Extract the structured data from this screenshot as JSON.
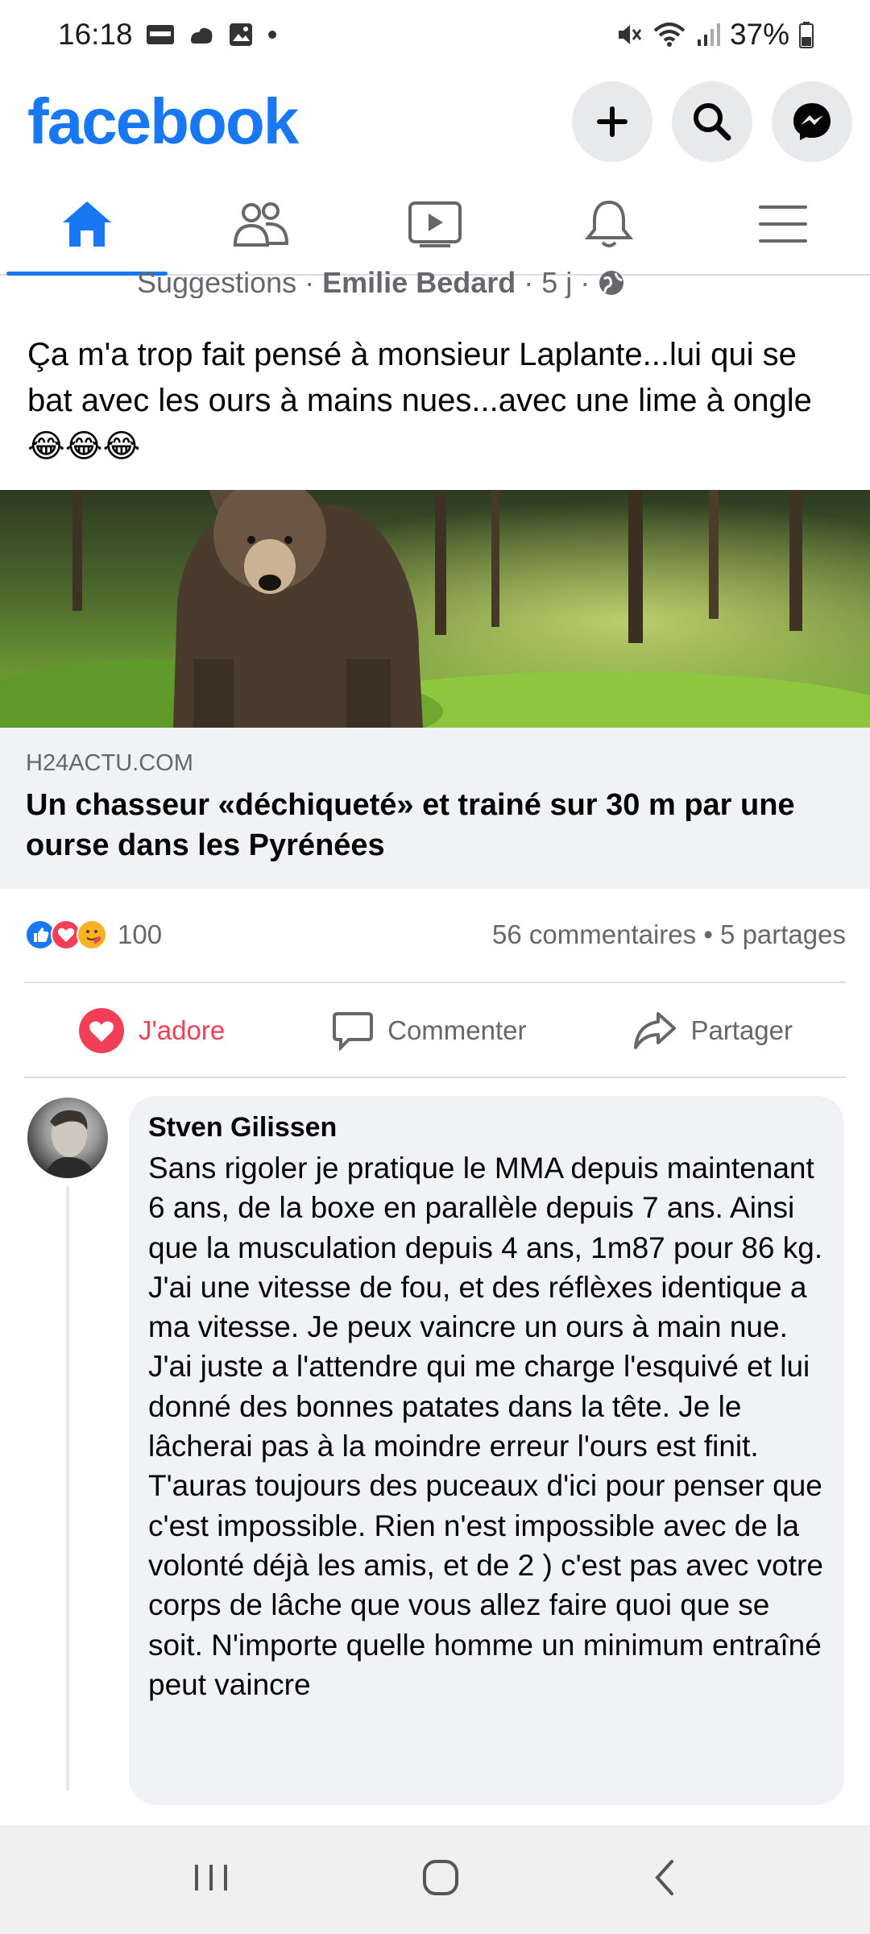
{
  "status_bar": {
    "time": "16:18",
    "battery": "37%"
  },
  "header": {
    "logo": "facebook"
  },
  "tabs": [
    {
      "name": "home",
      "icon": "home-icon",
      "active": true
    },
    {
      "name": "friends",
      "icon": "friends-icon",
      "active": false
    },
    {
      "name": "watch",
      "icon": "video-icon",
      "active": false
    },
    {
      "name": "notifications",
      "icon": "bell-icon",
      "active": false
    },
    {
      "name": "menu",
      "icon": "hamburger-menu-icon",
      "active": false
    }
  ],
  "post": {
    "meta_prefix": "Suggestions · ",
    "author": "Emilie Bedard",
    "meta_suffix": " · 5 j · ",
    "text": "Ça m'a trop fait pensé à monsieur Laplante...lui qui se bat avec les ours à mains nues...avec une lime à ongle 😂😂😂",
    "link": {
      "domain": "H24ACTU.COM",
      "title": "Un chasseur «déchiqueté» et trainé sur 30 m par une ourse dans les Pyrénées"
    },
    "reaction_count": "100",
    "comments_shares": "56 commentaires • 5 partages",
    "actions": {
      "like": "J'adore",
      "comment": "Commenter",
      "share": "Partager"
    }
  },
  "comment": {
    "author": "Stven Gilissen",
    "text": "Sans rigoler je pratique le MMA depuis maintenant 6 ans, de la boxe en parallèle depuis 7 ans. Ainsi que la musculation depuis 4 ans, 1m87 pour 86 kg. J'ai une vitesse de fou, et des réflèxes identique a ma vitesse. Je peux vaincre un ours à main nue. J'ai juste a l'attendre qui me charge l'esquivé et lui donné des bonnes patates dans la tête. Je le lâcherai pas à la moindre erreur l'ours est finit. T'auras toujours des puceaux d'ici pour penser que c'est impossible. Rien n'est impossible avec de la volonté déjà les amis, et de 2 ) c'est pas avec votre corps de lâche que vous allez faire quoi que se soit. N'importe quelle homme un minimum entraîné peut vaincre"
  },
  "colors": {
    "brand": "#1877f2",
    "love": "#f33e58"
  }
}
